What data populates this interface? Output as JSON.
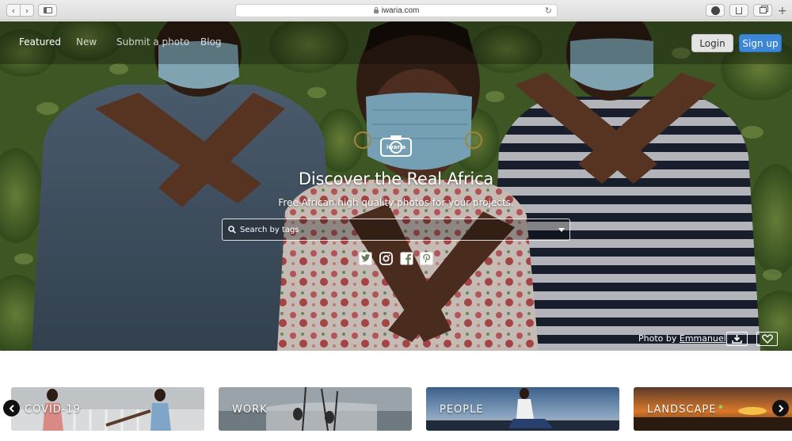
{
  "browser": {
    "address": "iwaria.com",
    "newtab_glyph": "+",
    "back_glyph": "‹",
    "forward_glyph": "›",
    "reload_glyph": "↻"
  },
  "nav": {
    "links": [
      "Featured",
      "New",
      "Submit a photo",
      "Blog"
    ],
    "login_label": "Login",
    "signup_label": "Sign up"
  },
  "hero": {
    "logo_text": "iwaria",
    "title": "Discover the Real Africa",
    "subtitle": "Free African high quality photos for your projects.",
    "search_placeholder": "Search by tags",
    "social": [
      "twitter-icon",
      "instagram-icon",
      "facebook-icon",
      "pinterest-icon"
    ],
    "credit_prefix": "Photo by",
    "credit_author": "Emmanuel"
  },
  "categories": [
    "COVID-19",
    "WORK",
    "PEOPLE",
    "LANDSCAPE"
  ],
  "colors": {
    "brand_blue": "#3b86d6",
    "mask_blue": "#8fc3d9"
  }
}
